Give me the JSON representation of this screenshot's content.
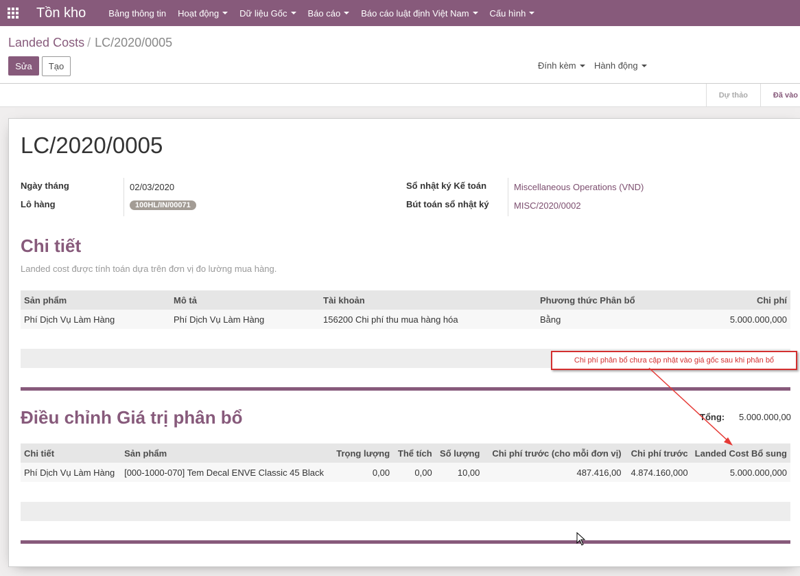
{
  "nav": {
    "brand": "Tồn kho",
    "menus": [
      "Bảng thông tin",
      "Hoạt động",
      "Dữ liệu Gốc",
      "Báo cáo",
      "Báo cáo luật định Việt Nam",
      "Cấu hình"
    ]
  },
  "breadcrumb": {
    "parent": "Landed Costs",
    "separator": "/",
    "current": "LC/2020/0005"
  },
  "buttons": {
    "edit": "Sửa",
    "create": "Tạo",
    "attach": "Đính kèm",
    "action": "Hành động"
  },
  "status": {
    "draft": "Dự thảo",
    "posted": "Đã vào"
  },
  "record": {
    "name": "LC/2020/0005",
    "date_label": "Ngày tháng",
    "date": "02/03/2020",
    "picking_label": "Lô hàng",
    "picking": "100HL/IN/00071",
    "journal_label": "Sổ nhật ký Kế toán",
    "journal": "Miscellaneous Operations (VND)",
    "move_label": "Bút toán sổ nhật ký",
    "move": "MISC/2020/0002"
  },
  "details": {
    "title": "Chi tiết",
    "hint": "Landed cost được tính toán dựa trên đơn vị đo lường mua hàng.",
    "columns": [
      "Sản phẩm",
      "Mô tả",
      "Tài khoản",
      "Phương thức Phân bổ",
      "Chi phí"
    ],
    "rows": [
      [
        "Phí Dịch Vụ Làm Hàng",
        "Phí Dịch Vụ Làm Hàng",
        "156200 Chi phí thu mua hàng hóa",
        "Bằng",
        "5.000.000,000"
      ]
    ]
  },
  "annotation": "Chi phí phân bổ chưa cập nhật vào giá gốc sau khi phân bổ",
  "adjustments": {
    "title": "Điều chỉnh Giá trị phân bổ",
    "total_label": "Tổng:",
    "total": "5.000.000,00",
    "columns": [
      "Chi tiết",
      "Sản phẩm",
      "Trọng lượng",
      "Thể tích",
      "Số lượng",
      "Chi phí trước (cho mỗi đơn vị)",
      "Chi phí trước",
      "Landed Cost Bổ sung"
    ],
    "rows": [
      [
        "Phí Dịch Vụ Làm Hàng",
        "[000-1000-070] Tem Decal ENVE Classic 45 Black",
        "0,00",
        "0,00",
        "10,00",
        "487.416,00",
        "4.874.160,000",
        "5.000.000,000"
      ]
    ]
  },
  "colors": {
    "brand": "#875a7b",
    "annotation": "#d32f2f"
  }
}
